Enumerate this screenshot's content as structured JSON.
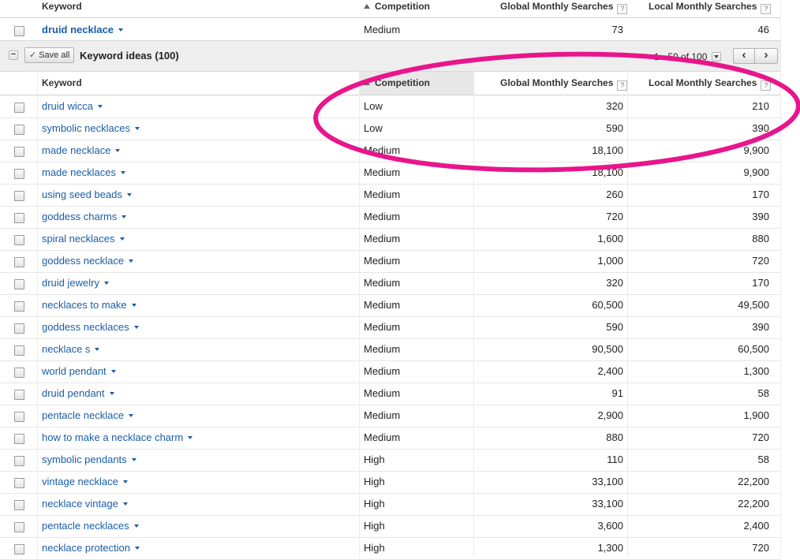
{
  "columns": {
    "keyword": "Keyword",
    "competition": "Competition",
    "global": "Global Monthly Searches",
    "local": "Local Monthly Searches",
    "help": "?"
  },
  "searched": {
    "keyword": "druid necklace",
    "competition": "Medium",
    "global": "73",
    "local": "46"
  },
  "ideas_bar": {
    "save_all_label": "Save all",
    "save_all_check": "✓",
    "collapse_symbol": "−",
    "title": "Keyword ideas (100)",
    "pagination": "1 - 50 of 100",
    "prev": "‹",
    "next": "›"
  },
  "rows": [
    {
      "keyword": "druid wicca",
      "competition": "Low",
      "global": "320",
      "local": "210"
    },
    {
      "keyword": "symbolic necklaces",
      "competition": "Low",
      "global": "590",
      "local": "390"
    },
    {
      "keyword": "made necklace",
      "competition": "Medium",
      "global": "18,100",
      "local": "9,900"
    },
    {
      "keyword": "made necklaces",
      "competition": "Medium",
      "global": "18,100",
      "local": "9,900"
    },
    {
      "keyword": "using seed beads",
      "competition": "Medium",
      "global": "260",
      "local": "170"
    },
    {
      "keyword": "goddess charms",
      "competition": "Medium",
      "global": "720",
      "local": "390"
    },
    {
      "keyword": "spiral necklaces",
      "competition": "Medium",
      "global": "1,600",
      "local": "880"
    },
    {
      "keyword": "goddess necklace",
      "competition": "Medium",
      "global": "1,000",
      "local": "720"
    },
    {
      "keyword": "druid jewelry",
      "competition": "Medium",
      "global": "320",
      "local": "170"
    },
    {
      "keyword": "necklaces to make",
      "competition": "Medium",
      "global": "60,500",
      "local": "49,500"
    },
    {
      "keyword": "goddess necklaces",
      "competition": "Medium",
      "global": "590",
      "local": "390"
    },
    {
      "keyword": "necklace s",
      "competition": "Medium",
      "global": "90,500",
      "local": "60,500"
    },
    {
      "keyword": "world pendant",
      "competition": "Medium",
      "global": "2,400",
      "local": "1,300"
    },
    {
      "keyword": "druid pendant",
      "competition": "Medium",
      "global": "91",
      "local": "58"
    },
    {
      "keyword": "pentacle necklace",
      "competition": "Medium",
      "global": "2,900",
      "local": "1,900"
    },
    {
      "keyword": "how to make a necklace charm",
      "competition": "Medium",
      "global": "880",
      "local": "720"
    },
    {
      "keyword": "symbolic pendants",
      "competition": "High",
      "global": "110",
      "local": "58"
    },
    {
      "keyword": "vintage necklace",
      "competition": "High",
      "global": "33,100",
      "local": "22,200"
    },
    {
      "keyword": "necklace vintage",
      "competition": "High",
      "global": "33,100",
      "local": "22,200"
    },
    {
      "keyword": "pentacle necklaces",
      "competition": "High",
      "global": "3,600",
      "local": "2,400"
    },
    {
      "keyword": "necklace protection",
      "competition": "High",
      "global": "1,300",
      "local": "720"
    }
  ],
  "colors": {
    "link": "#1a5ea8",
    "annotation": "#e8158c"
  }
}
